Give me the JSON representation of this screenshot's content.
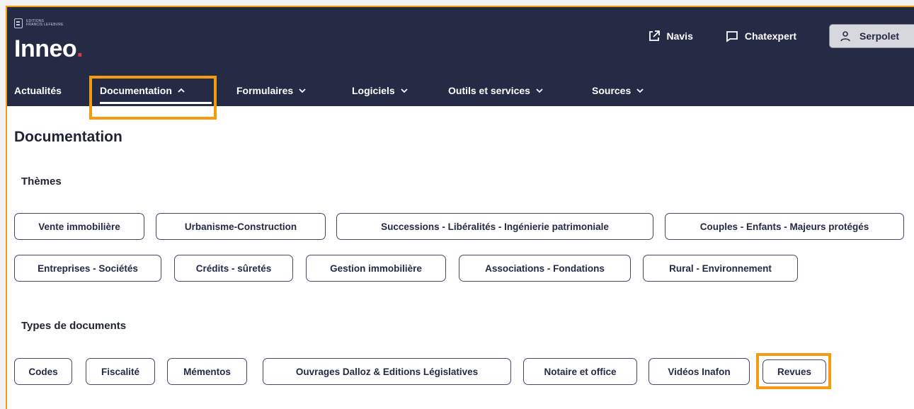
{
  "brand": {
    "small_line1": "EDITIONS",
    "small_line2": "FRANCIS LEFEBVRE",
    "logo_text": "Inneo",
    "logo_dot": "."
  },
  "actions": {
    "navis": {
      "label": "Navis",
      "icon": "external-link-icon"
    },
    "chatexpert": {
      "label": "Chatexpert",
      "icon": "chat-bubble-icon"
    },
    "user": {
      "label": "Serpolet",
      "icon": "user-icon"
    }
  },
  "nav": {
    "items": [
      {
        "label": "Actualités",
        "chevron": ""
      },
      {
        "label": "Documentation",
        "chevron": "^"
      },
      {
        "label": "Formulaires",
        "chevron": "v"
      },
      {
        "label": "Logiciels",
        "chevron": "v"
      },
      {
        "label": "Outils et services",
        "chevron": "v"
      },
      {
        "label": "Sources",
        "chevron": "v"
      }
    ]
  },
  "page": {
    "title": "Documentation"
  },
  "themes": {
    "title": "Thèmes",
    "items": [
      "Vente immobilière",
      "Urbanisme-Construction",
      "Successions - Libéralités - Ingénierie patrimoniale",
      "Couples - Enfants - Majeurs protégés",
      "Entreprises - Sociétés",
      "Crédits - sûretés",
      "Gestion immobilière",
      "Associations - Fondations",
      "Rural - Environnement"
    ]
  },
  "types": {
    "title": "Types de documents",
    "items": [
      "Codes",
      "Fiscalité",
      "Mémentos",
      "Ouvrages Dalloz & Editions Législatives",
      "Notaire et office",
      "Vidéos Inafon",
      "Revues"
    ]
  },
  "colors": {
    "header_bg": "#252a45",
    "highlight": "#f39c12",
    "logo_dot": "#d23b4a",
    "chip_border": "#434a68"
  }
}
